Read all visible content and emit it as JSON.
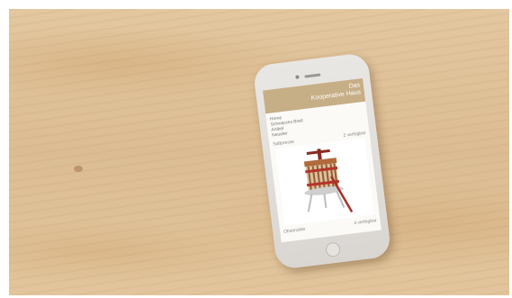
{
  "app": {
    "brand_line1": "Das",
    "brand_line2": "Kooperative Haus"
  },
  "menu": {
    "items": [
      "Home",
      "Schwarzes Brett",
      "Artikel",
      "Neueler"
    ]
  },
  "product": {
    "name": "Saftpresse",
    "availability": "2 verfügbar",
    "image_icon": "fruit-press-icon"
  },
  "next_item": {
    "name": "Obstmühle",
    "availability": "4 verfügbar"
  },
  "colors": {
    "header": "#c6ae86",
    "wood": "#dfc39a"
  }
}
